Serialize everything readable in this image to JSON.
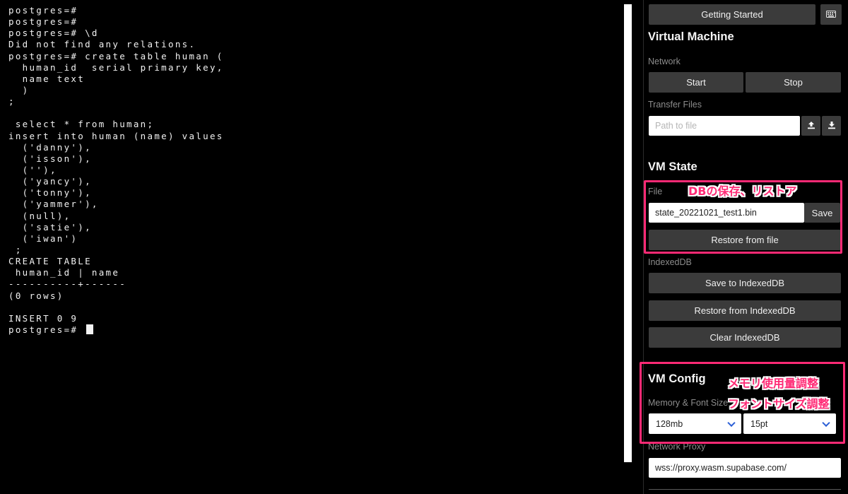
{
  "terminal": {
    "lines": [
      "postgres=#",
      "postgres=#",
      "postgres=# \\d",
      "Did not find any relations.",
      "postgres=# create table human (",
      "  human_id  serial primary key,",
      "  name text",
      "  )",
      ";",
      "",
      " select * from human;",
      "insert into human (name) values",
      "  ('danny'),",
      "  ('isson'),",
      "  (''),",
      "  ('yancy'),",
      "  ('tonny'),",
      "  ('yammer'),",
      "  (null),",
      "  ('satie'),",
      "  ('iwan')",
      " ;",
      "CREATE TABLE",
      " human_id | name",
      "----------+------",
      "(0 rows)",
      "",
      "INSERT 0 9",
      "postgres=# "
    ]
  },
  "panel": {
    "getting_started": "Getting Started",
    "keyboard_icon": "keyboard-icon",
    "vm_heading": "Virtual Machine",
    "network_label": "Network",
    "start_label": "Start",
    "stop_label": "Stop",
    "transfer_label": "Transfer Files",
    "path_placeholder": "Path to file",
    "upload_icon": "upload-icon",
    "download_icon": "download-icon",
    "vm_state_heading": "VM State",
    "file_label": "File",
    "state_file_value": "state_20221021_test1.bin",
    "save_label": "Save",
    "restore_file_label": "Restore from file",
    "indexeddb_label": "IndexedDB",
    "save_idb_label": "Save to IndexedDB",
    "restore_idb_label": "Restore from IndexedDB",
    "clear_idb_label": "Clear IndexedDB",
    "vm_config_heading": "VM Config",
    "memory_font_label": "Memory & Font Size",
    "memory_value": "128mb",
    "font_value": "15pt",
    "proxy_label": "Network Proxy",
    "proxy_value": "wss://proxy.wasm.supabase.com/"
  },
  "annotations": {
    "db_save_restore": "DBの保存、リストア",
    "memory_adjust": "メモリ使用量調整",
    "font_adjust": "フォントサイズ調整",
    "highlight_color": "#ff2a75"
  }
}
